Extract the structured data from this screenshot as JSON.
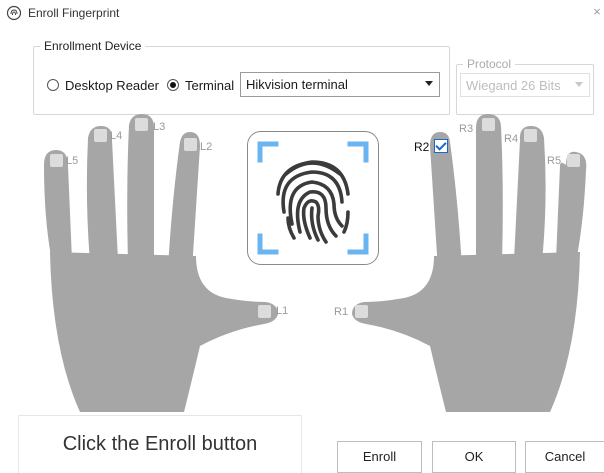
{
  "window": {
    "title": "Enroll Fingerprint",
    "close_glyph": "×"
  },
  "enrollment_device": {
    "legend": "Enrollment Device",
    "options": [
      {
        "label": "Desktop Reader",
        "selected": false
      },
      {
        "label": "Terminal",
        "selected": true
      }
    ],
    "device_select": {
      "value": "Hikvision terminal"
    }
  },
  "protocol": {
    "legend": "Protocol",
    "value": "Wiegand 26 Bits",
    "enabled": false
  },
  "fingers": {
    "left": [
      "L1",
      "L2",
      "L3",
      "L4",
      "L5"
    ],
    "right": [
      "R1",
      "R2",
      "R3",
      "R4",
      "R5"
    ],
    "selected": "R2"
  },
  "status_text": "Click the Enroll button",
  "buttons": {
    "enroll": "Enroll",
    "ok": "OK",
    "cancel": "Cancel"
  },
  "colors": {
    "hand": "#a6a6a6",
    "fingertip": "#dcdcdc",
    "fingerprint_dark": "#3b3b3b",
    "scan_corner": "#6ab4f0",
    "checkbox": "#1b6ac9"
  },
  "icons": {
    "app": "fingerprint-app-icon",
    "fingerprint": "fingerprint-scan-icon"
  }
}
